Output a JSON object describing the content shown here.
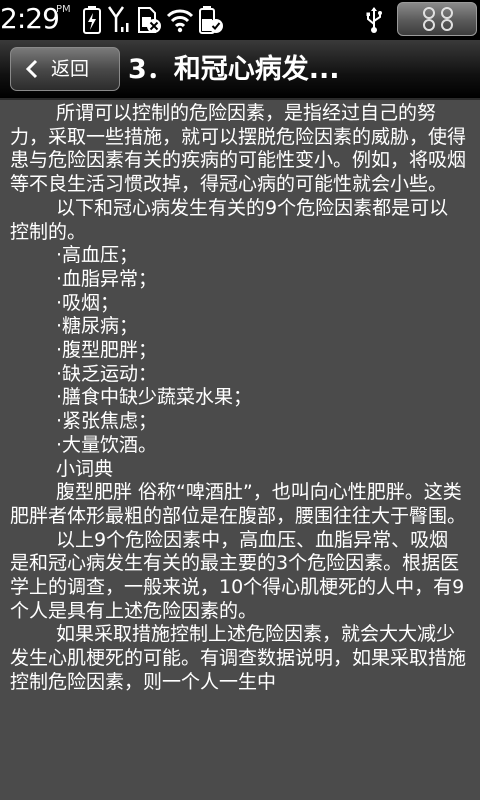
{
  "status_bar": {
    "time": "2:29",
    "ampm": "PM",
    "icons": [
      "battery-charging-icon",
      "signal-icon",
      "sim-off-icon",
      "wifi-icon",
      "battery-icon",
      "usb-icon",
      "menu-icon"
    ]
  },
  "header": {
    "back_label": "返回",
    "title": "3．和冠心病发..."
  },
  "article": {
    "paragraphs": [
      {
        "style": "indent",
        "text": "所谓可以控制的危险因素，是指经过自己的努力，采取一些措施，就可以摆脱危险因素的威胁，使得患与危险因素有关的疾病的可能性变小。例如，将吸烟等不良生活习惯改掉，得冠心病的可能性就会小些。"
      },
      {
        "style": "indent",
        "text": "以下和冠心病发生有关的9个危险因素都是可以控制的。"
      },
      {
        "style": "item",
        "text": "·高血压；"
      },
      {
        "style": "item",
        "text": "·血脂异常；"
      },
      {
        "style": "item",
        "text": "·吸烟；"
      },
      {
        "style": "item",
        "text": "·糖尿病；"
      },
      {
        "style": "item",
        "text": "·腹型肥胖；"
      },
      {
        "style": "item",
        "text": "·缺乏运动："
      },
      {
        "style": "item",
        "text": "·膳食中缺少蔬菜水果；"
      },
      {
        "style": "item",
        "text": "·紧张焦虑；"
      },
      {
        "style": "item",
        "text": "·大量饮酒。"
      },
      {
        "style": "item",
        "text": "小词典"
      },
      {
        "style": "indent",
        "text": "腹型肥胖 俗称“啤酒肚”，也叫向心性肥胖。这类肥胖者体形最粗的部位是在腹部，腰围往往大于臀围。"
      },
      {
        "style": "indent",
        "text": "以上9个危险因素中，高血压、血脂异常、吸烟是和冠心病发生有关的最主要的3个危险因素。根据医学上的调查，一般来说，10个得心肌梗死的人中，有9个人是具有上述危险因素的。"
      },
      {
        "style": "indent",
        "text": "如果采取措施控制上述危险因素，就会大大减少发生心肌梗死的可能。有调查数据说明，如果采取措施控制危险因素，则一个人一生中"
      }
    ]
  }
}
